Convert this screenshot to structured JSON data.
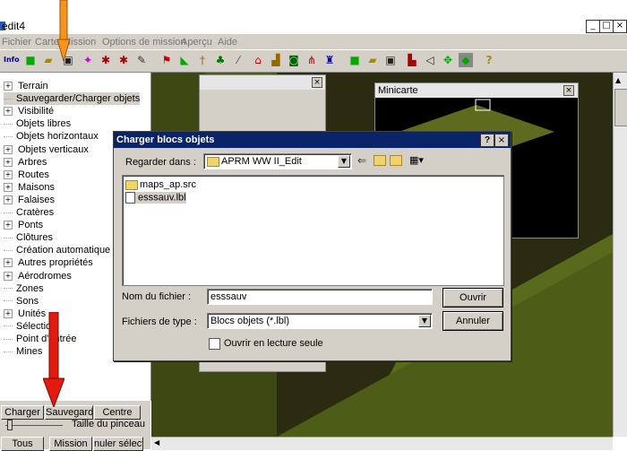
{
  "app": {
    "title": "edit4"
  },
  "window_buttons": {
    "min": "_",
    "max": "□",
    "close": "×"
  },
  "menu": [
    "Fichier",
    "Carte",
    "Mission",
    "Options de mission",
    "Aperçu",
    "Aide"
  ],
  "toolbar": {
    "info_label": "Info"
  },
  "tree": [
    {
      "label": "Terrain",
      "expandable": true
    },
    {
      "label": "Sauvegarder/Charger objets",
      "expandable": false,
      "selected": true
    },
    {
      "label": "Visibilité",
      "expandable": true
    },
    {
      "label": "Objets libres",
      "expandable": false
    },
    {
      "label": "Objets horizontaux",
      "expandable": false
    },
    {
      "label": "Objets verticaux",
      "expandable": true
    },
    {
      "label": "Arbres",
      "expandable": true
    },
    {
      "label": "Routes",
      "expandable": true
    },
    {
      "label": "Maisons",
      "expandable": true
    },
    {
      "label": "Falaises",
      "expandable": true
    },
    {
      "label": "Cratères",
      "expandable": false
    },
    {
      "label": "Ponts",
      "expandable": true
    },
    {
      "label": "Clôtures",
      "expandable": false
    },
    {
      "label": "Création automatique",
      "expandable": false
    },
    {
      "label": "Autres propriétés",
      "expandable": true
    },
    {
      "label": "Aérodromes",
      "expandable": true
    },
    {
      "label": "Zones",
      "expandable": false
    },
    {
      "label": "Sons",
      "expandable": false
    },
    {
      "label": "Unités",
      "expandable": true
    },
    {
      "label": "Sélection",
      "expandable": false
    },
    {
      "label": "Point d'entrée",
      "expandable": false
    },
    {
      "label": "Mines",
      "expandable": false
    }
  ],
  "bottom": {
    "charger": "Charger",
    "sauvegarde": "Sauvegarde",
    "centre": "Centre",
    "brush_label": "Taille du pinceau",
    "tous": "Tous",
    "mission": "Mission",
    "annuler": "nuler sélect"
  },
  "minimap": {
    "title": "Minicarte",
    "close": "×"
  },
  "dialog": {
    "title": "Charger blocs objets",
    "help": "?",
    "close": "×",
    "look_in_label": "Regarder dans :",
    "look_in_value": "APRM WW II_Edit",
    "files": [
      {
        "name": "maps_ap.src",
        "type": "folder"
      },
      {
        "name": "esssauv.lbl",
        "type": "file",
        "selected": true
      }
    ],
    "filename_label": "Nom du fichier :",
    "filename_value": "esssauv",
    "filetype_label": "Fichiers de type :",
    "filetype_value": "Blocs objets (*.lbl)",
    "readonly_label": "Ouvrir en lecture seule",
    "readonly_checked": false,
    "open_button": "Ouvrir",
    "cancel_button": "Annuler"
  },
  "colors": {
    "dialog_title_bg": "#0a246a",
    "map_bg": "#2b2b12",
    "terrain": "#5e6b1e",
    "arrow_orange": "#f7931e",
    "arrow_red": "#e21a10"
  }
}
